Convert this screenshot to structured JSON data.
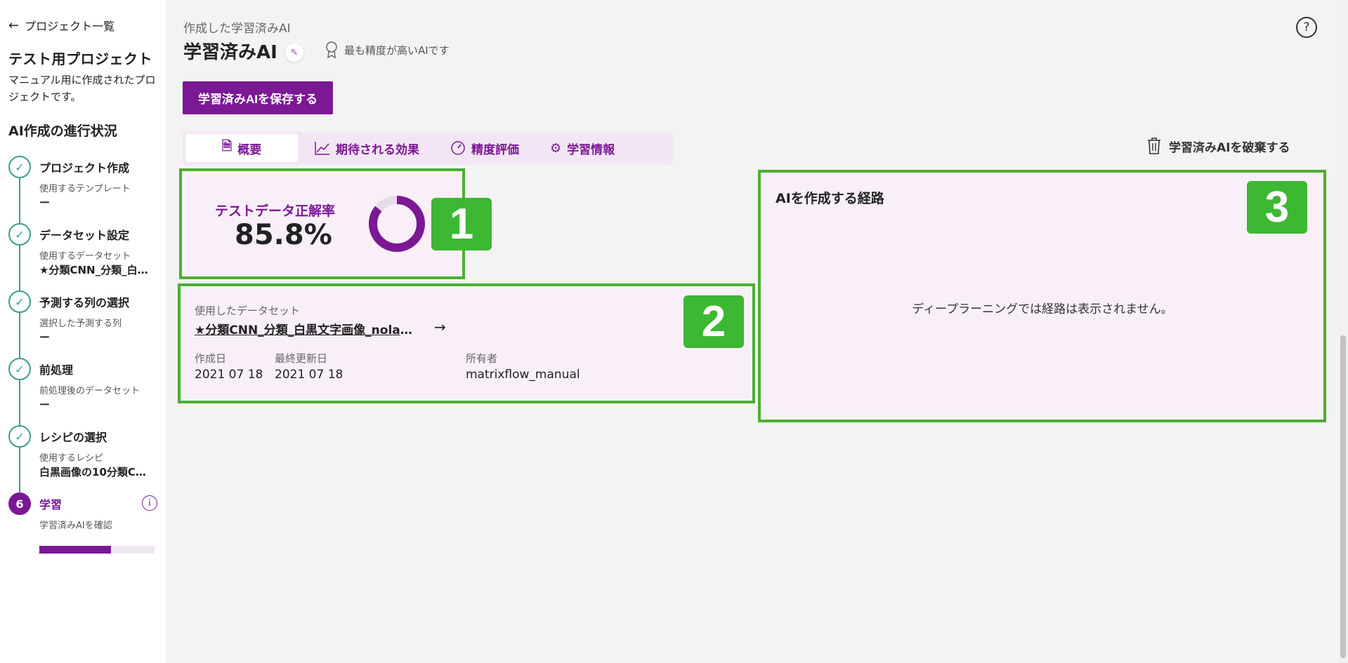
{
  "sidebar": {
    "back_label": "プロジェクト一覧",
    "project_title": "テスト用プロジェクト",
    "project_desc": "マニュアル用に作成されたプロジェクトです。",
    "progress_title": "AI作成の進行状況",
    "steps": [
      {
        "title": "プロジェクト作成",
        "sub": "使用するテンプレート",
        "value": "ー"
      },
      {
        "title": "データセット設定",
        "sub": "使用するデータセット",
        "value": "★分類CNN_分類_白…"
      },
      {
        "title": "予測する列の選択",
        "sub": "選択した予測する列",
        "value": "ー"
      },
      {
        "title": "前処理",
        "sub": "前処理後のデータセット",
        "value": "ー"
      },
      {
        "title": "レシピの選択",
        "sub": "使用するレシピ",
        "value": "白黒画像の10分類C…"
      },
      {
        "number": "6",
        "title": "学習",
        "sub": "学習済みAIを確認",
        "progress": 0.62
      }
    ]
  },
  "header": {
    "crumb": "作成した学習済みAI",
    "title": "学習済みAI",
    "badge": "最も精度が高いAIです",
    "save_label": "学習済みAIを保存する",
    "discard_label": "学習済みAIを破棄する"
  },
  "tabs": [
    {
      "label": "概要",
      "icon": "document-icon"
    },
    {
      "label": "期待される効果",
      "icon": "line-chart-icon"
    },
    {
      "label": "精度評価",
      "icon": "gauge-icon"
    },
    {
      "label": "学習情報",
      "icon": "gear-icon"
    }
  ],
  "accuracy": {
    "label": "テストデータ正解率",
    "value": "85.8%",
    "fraction": 0.858
  },
  "dataset": {
    "label": "使用したデータセット",
    "name": "★分類CNN_分類_白黒文字画像_nolabel",
    "created_label": "作成日",
    "created": "2021 07 18",
    "updated_label": "最終更新日",
    "updated": "2021 07 18",
    "owner_label": "所有者",
    "owner": "matrixflow_manual"
  },
  "route": {
    "title": "AIを作成する経路",
    "message": "ディープラーニングでは経路は表示されません。"
  },
  "annotations": [
    "1",
    "2",
    "3"
  ],
  "colors": {
    "accent": "#7b1894",
    "check": "#3a9e8f",
    "annotation": "#4caf32"
  }
}
